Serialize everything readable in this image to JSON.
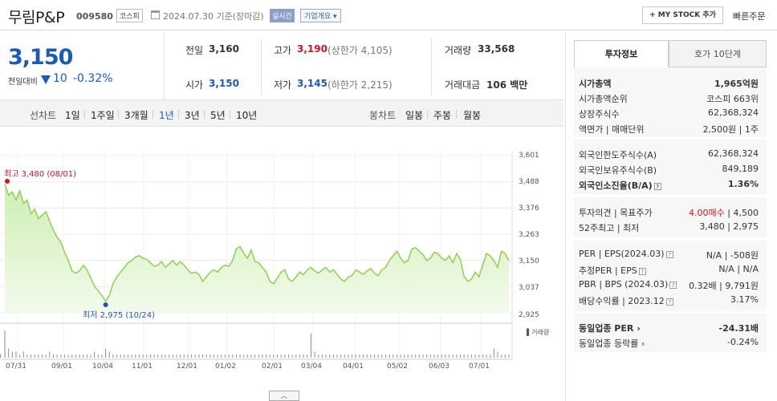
{
  "header": {
    "stock_name": "무림P&P",
    "stock_code": "009580",
    "market": "코스피",
    "date_text": "2024.07.30 기준(장마감)",
    "realtime": "실시간",
    "corp_info": "기업개요 ▾",
    "mystock_btn": "+ MY STOCK 추가",
    "quick_order": "빠른주문"
  },
  "price": {
    "current": "3,150",
    "change_label": "전일대비",
    "change_value": "10",
    "change_pct": "-0.32%"
  },
  "stats": {
    "prev_close_label": "전일",
    "prev_close": "3,160",
    "high_label": "고가",
    "high": "3,190",
    "high_limit": "(상한가 4,105)",
    "volume_label": "거래량",
    "volume": "33,568",
    "open_label": "시가",
    "open": "3,150",
    "low_label": "저가",
    "low": "3,145",
    "low_limit": "(하한가 2,215)",
    "amount_label": "거래대금",
    "amount": "106 백만"
  },
  "period": {
    "line_label": "선차트",
    "line_items": [
      "1일",
      "1주일",
      "3개월",
      "1년",
      "3년",
      "5년",
      "10년"
    ],
    "selected": "1년",
    "candle_label": "봉차트",
    "candle_items": [
      "일봉",
      "주봉",
      "월봉"
    ]
  },
  "chart_data": {
    "type": "area",
    "y_ticks": [
      "3,601",
      "3,488",
      "3,376",
      "3,263",
      "3,150",
      "3,037",
      "2,925"
    ],
    "x_ticks": [
      "07/31",
      "09/01",
      "10/04",
      "11/01",
      "12/01",
      "01/02",
      "02/01",
      "03/04",
      "04/01",
      "05/02",
      "06/03",
      "07/01"
    ],
    "ylim": [
      2925,
      3601
    ],
    "high_label": "최고 3,480 (08/01)",
    "low_label": "최저 2,975 (10/24)",
    "volume_label": "거래량",
    "line_color": "#8fd14f",
    "fill_color": "#dff5cf",
    "values": [
      3480,
      3430,
      3445,
      3410,
      3450,
      3395,
      3410,
      3350,
      3370,
      3330,
      3345,
      3360,
      3320,
      3280,
      3250,
      3230,
      3185,
      3150,
      3105,
      3095,
      3105,
      3130,
      3110,
      3075,
      3040,
      3020,
      3000,
      2975,
      3000,
      3050,
      3080,
      3100,
      3120,
      3140,
      3150,
      3165,
      3170,
      3160,
      3155,
      3140,
      3125,
      3130,
      3145,
      3120,
      3135,
      3150,
      3130,
      3145,
      3130,
      3110,
      3095,
      3100,
      3090,
      3060,
      3080,
      3100,
      3110,
      3100,
      3120,
      3130,
      3125,
      3150,
      3200,
      3210,
      3180,
      3160,
      3195,
      3145,
      3140,
      3120,
      3100,
      3060,
      3050,
      3075,
      3100,
      3110,
      3070,
      3060,
      3080,
      3100,
      3090,
      3110,
      3120,
      3105,
      3095,
      3110,
      3120,
      3100,
      3110,
      3090,
      3070,
      3060,
      3080,
      3085,
      3110,
      3100,
      3090,
      3105,
      3115,
      3095,
      3085,
      3110,
      3120,
      3150,
      3170,
      3190,
      3160,
      3140,
      3150,
      3200,
      3205,
      3190,
      3175,
      3150,
      3160,
      3185,
      3180,
      3160,
      3150,
      3170,
      3140,
      3180,
      3155,
      3080,
      3060,
      3070,
      3100,
      3080,
      3130,
      3180,
      3170,
      3150,
      3120,
      3190,
      3180,
      3150
    ],
    "volumes": [
      9,
      3,
      2,
      2,
      1,
      2,
      1,
      1,
      1,
      1,
      1,
      1,
      2,
      1,
      1,
      1,
      1,
      1,
      1,
      1,
      1,
      1,
      1,
      1,
      2,
      1,
      1,
      3,
      2,
      1,
      1,
      1,
      1,
      1,
      1,
      1,
      1,
      1,
      1,
      1,
      1,
      1,
      1,
      1,
      1,
      1,
      1,
      1,
      1,
      1,
      1,
      1,
      1,
      1,
      1,
      1,
      1,
      1,
      1,
      1,
      1,
      1,
      1,
      1,
      1,
      1,
      1,
      1,
      1,
      1,
      1,
      1,
      1,
      1,
      1,
      1,
      1,
      1,
      1,
      1,
      1,
      1,
      8,
      2,
      1,
      1,
      1,
      1,
      1,
      1,
      1,
      1,
      1,
      1,
      1,
      1,
      1,
      1,
      1,
      1,
      1,
      1,
      1,
      1,
      1,
      1,
      1,
      1,
      1,
      1,
      1,
      1,
      1,
      1,
      1,
      1,
      1,
      1,
      1,
      1,
      1,
      1,
      1,
      1,
      1,
      1,
      1,
      1,
      1,
      1,
      1,
      3,
      2,
      1,
      1,
      1,
      1,
      1,
      1,
      1
    ]
  },
  "collapse_btn": "︿",
  "side": {
    "tab_active": "투자정보",
    "tab_other": "호가 10단계",
    "g1": [
      {
        "label": "시가총액",
        "value": "1,965억원",
        "bold": true
      },
      {
        "label": "시가총액순위",
        "value": "코스피 663위"
      },
      {
        "label": "상장주식수",
        "value": "62,368,324"
      },
      {
        "label": "액면가 | 매매단위",
        "value": "2,500원 | 1주"
      }
    ],
    "g2": [
      {
        "label": "외국인한도주식수(A)",
        "value": "62,368,324"
      },
      {
        "label": "외국인보유주식수(B)",
        "value": "849,189"
      },
      {
        "label": "외국인소진율(B/A)",
        "value": "1.36%",
        "bold": true
      }
    ],
    "g3_opinion_label": "투자의견 | 목표주가",
    "g3_opinion_value": "4.00매수",
    "g3_target_value": "| 4,500",
    "g3_52w_label": "52주최고 | 최저",
    "g3_52w_value": "3,480 | 2,975",
    "g4": [
      {
        "label": "PER | EPS(2024.03)",
        "value": "N/A | -508원"
      },
      {
        "label": "추정PER | EPS",
        "value": "N/A | N/A"
      },
      {
        "label": "PBR | BPS (2024.03)",
        "value": "0.32배 | 9,791원"
      },
      {
        "label": "배당수익률 | 2023.12",
        "value": "3.17%"
      }
    ],
    "g5": [
      {
        "label": "동일업종 PER",
        "value": "-24.31배",
        "bold": true
      },
      {
        "label": "동일업종 등락률",
        "value": "-0.24%",
        "blue": true
      }
    ]
  }
}
